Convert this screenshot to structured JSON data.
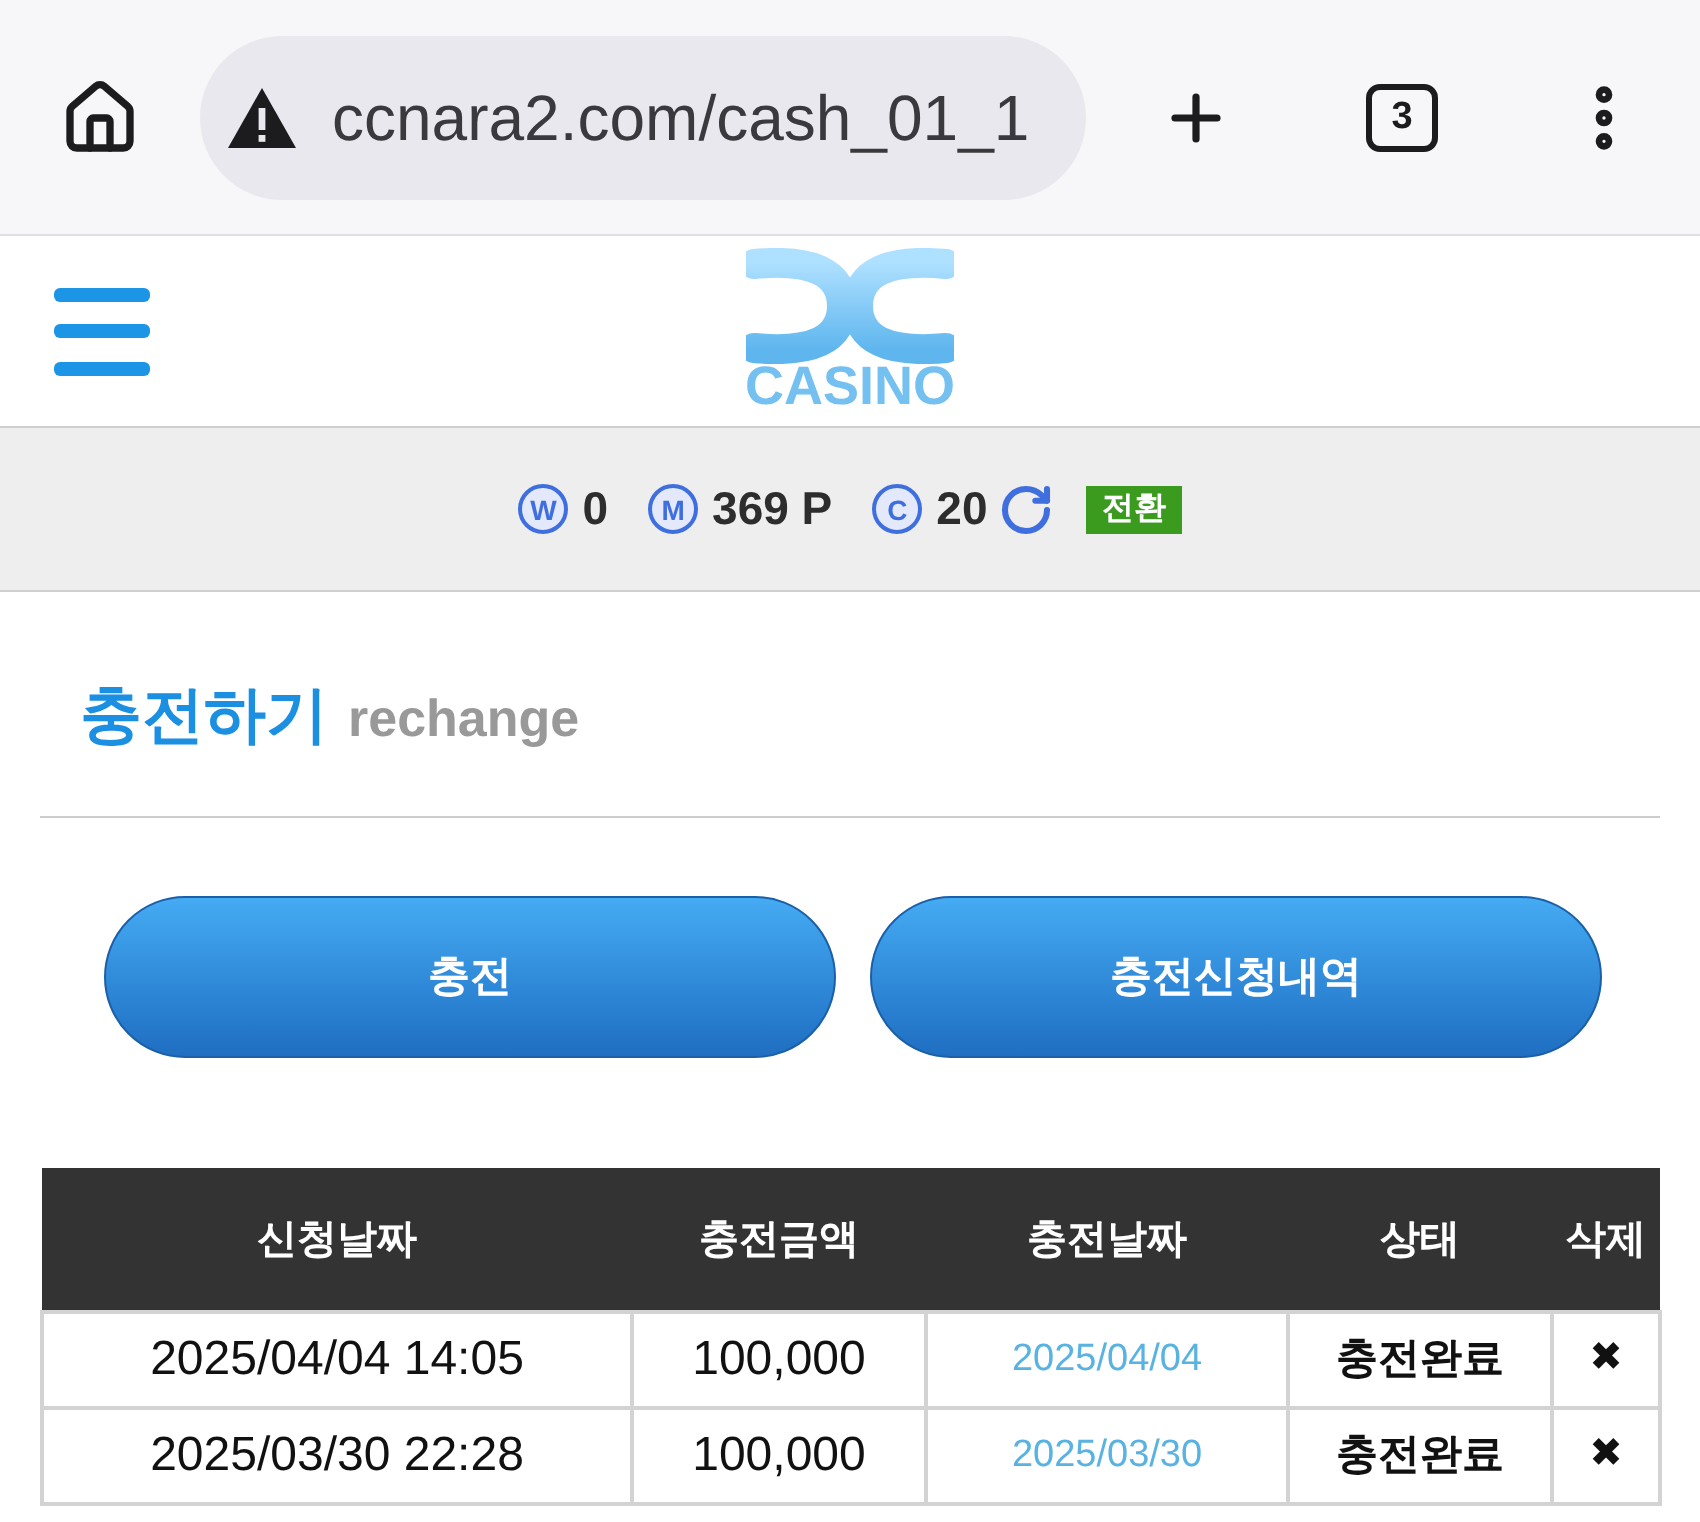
{
  "browser": {
    "url": "ccnara2.com/cash_01_1",
    "tab_count": "3"
  },
  "header": {
    "logo_text": "CASINO"
  },
  "balance_bar": {
    "items": [
      {
        "symbol": "W",
        "value": "0"
      },
      {
        "symbol": "M",
        "value": "369 P"
      },
      {
        "symbol": "C",
        "value": "20"
      }
    ],
    "convert_button": "전환"
  },
  "section": {
    "title": "충전하기",
    "subtitle": "rechange"
  },
  "buttons": [
    "충전",
    "충전신청내역"
  ],
  "table": {
    "columns": [
      "신청날짜",
      "충전금액",
      "충전날짜",
      "상태",
      "삭제"
    ],
    "rows": [
      {
        "request_date": "2025/04/04 14:05",
        "amount": "100,000",
        "charge_date": "2025/04/04",
        "status": "충전완료",
        "delete": "✖"
      },
      {
        "request_date": "2025/03/30 22:28",
        "amount": "100,000",
        "charge_date": "2025/03/30",
        "status": "충전완료",
        "delete": "✖"
      }
    ]
  }
}
